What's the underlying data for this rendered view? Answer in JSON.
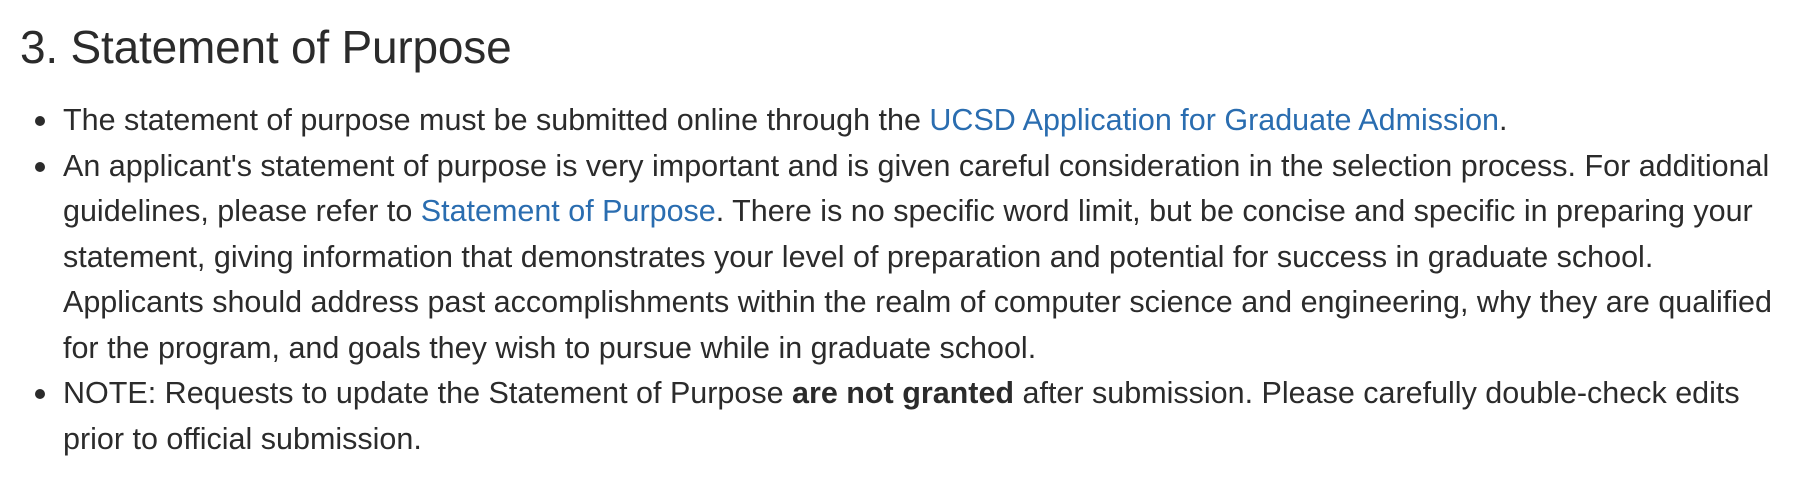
{
  "section": {
    "heading": "3. Statement of Purpose",
    "items": [
      {
        "text_before": "The statement of purpose must be submitted online through the ",
        "link": "UCSD Application for Graduate Admission",
        "text_after": "."
      },
      {
        "text_before": "An applicant's statement of purpose is very important and is given careful consideration in the selection process. For additional guidelines, please refer to ",
        "link": "Statement of Purpose",
        "text_after": ". There is no specific word limit, but be concise and specific in preparing your statement, giving information that demonstrates your level of preparation and potential for success in graduate school. Applicants should address past accomplishments within the realm of computer science and engineering, why they are qualified for the program, and goals they wish to pursue while in graduate school."
      },
      {
        "text_before": "NOTE: Requests to update the Statement of Purpose ",
        "bold": "are not granted",
        "text_after": " after submission. Please carefully double-check edits prior to official submission."
      }
    ]
  },
  "colors": {
    "text": "#2b2b2b",
    "link": "#2a6db0",
    "background": "#ffffff"
  }
}
